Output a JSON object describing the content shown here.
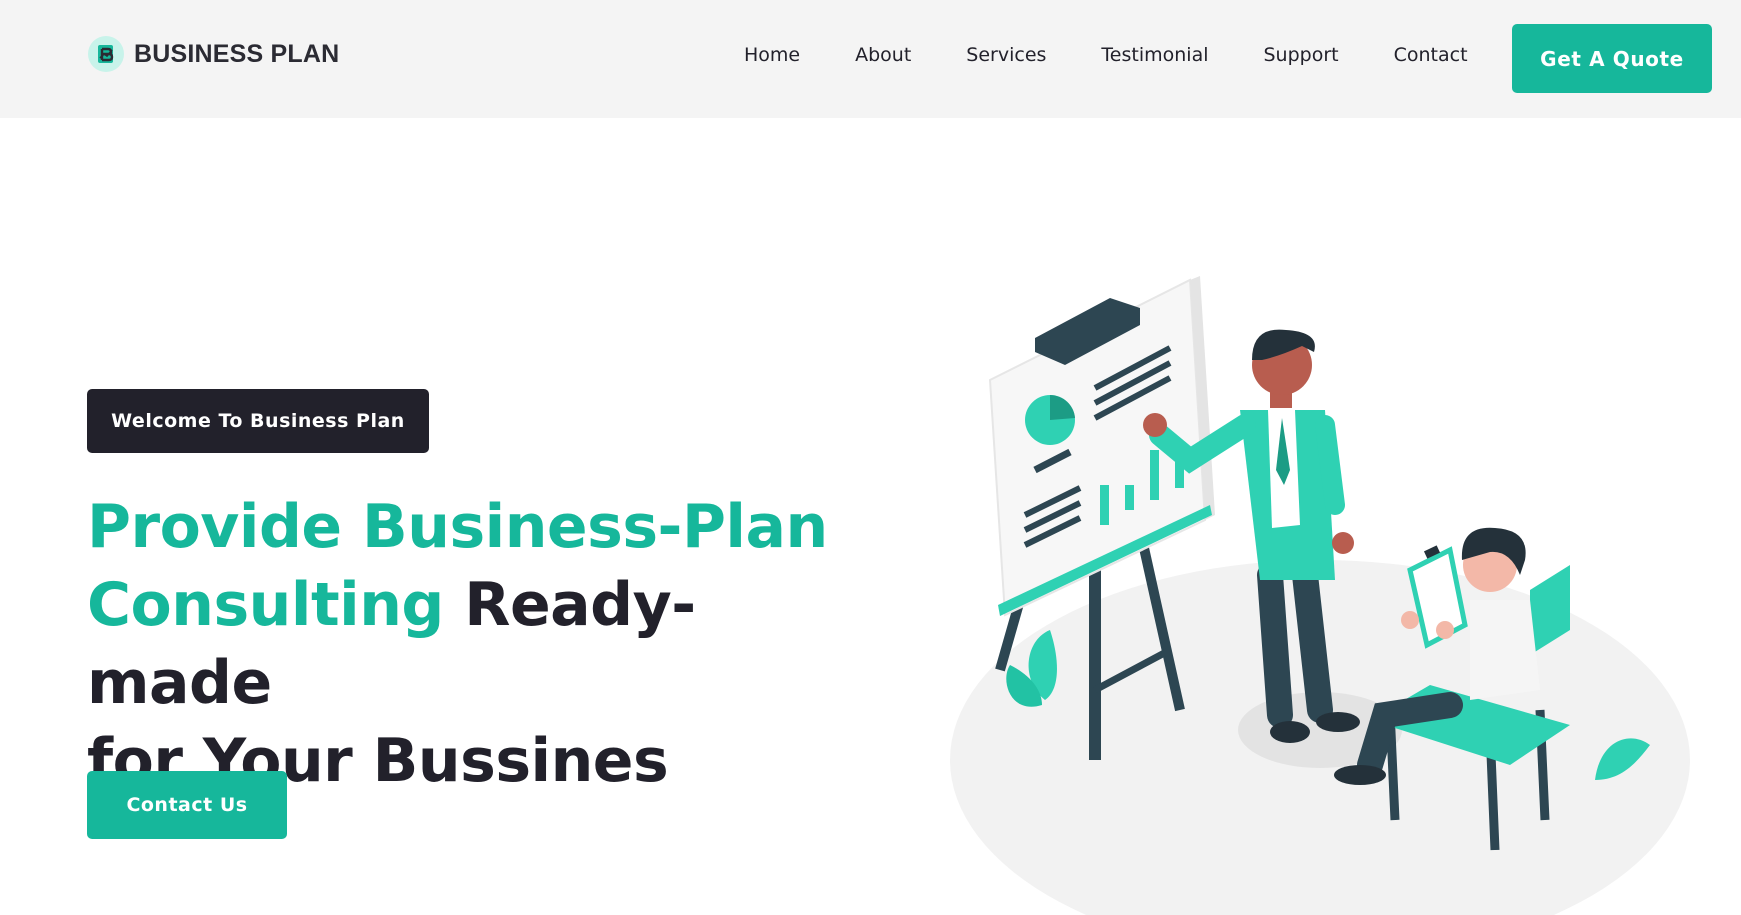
{
  "brand": {
    "name": "BUSINESS PLAN"
  },
  "nav": {
    "items": [
      {
        "label": "Home"
      },
      {
        "label": "About"
      },
      {
        "label": "Services"
      },
      {
        "label": "Testimonial"
      },
      {
        "label": "Support"
      },
      {
        "label": "Contact"
      }
    ],
    "cta_label": "Get A Quote"
  },
  "hero": {
    "badge": "Welcome To Business Plan",
    "headline_accent_1": "Provide Business-Plan",
    "headline_accent_2": "Consulting",
    "headline_rest_1": " Ready-made",
    "headline_rest_2": "for Your Bussines",
    "cta_label": "Contact Us"
  },
  "colors": {
    "accent": "#16b79b",
    "dark": "#22212b",
    "nav_bg": "#f4f4f4"
  },
  "icons": {
    "logo": "chart-logo-icon",
    "illustration": "business-presentation-illustration"
  }
}
